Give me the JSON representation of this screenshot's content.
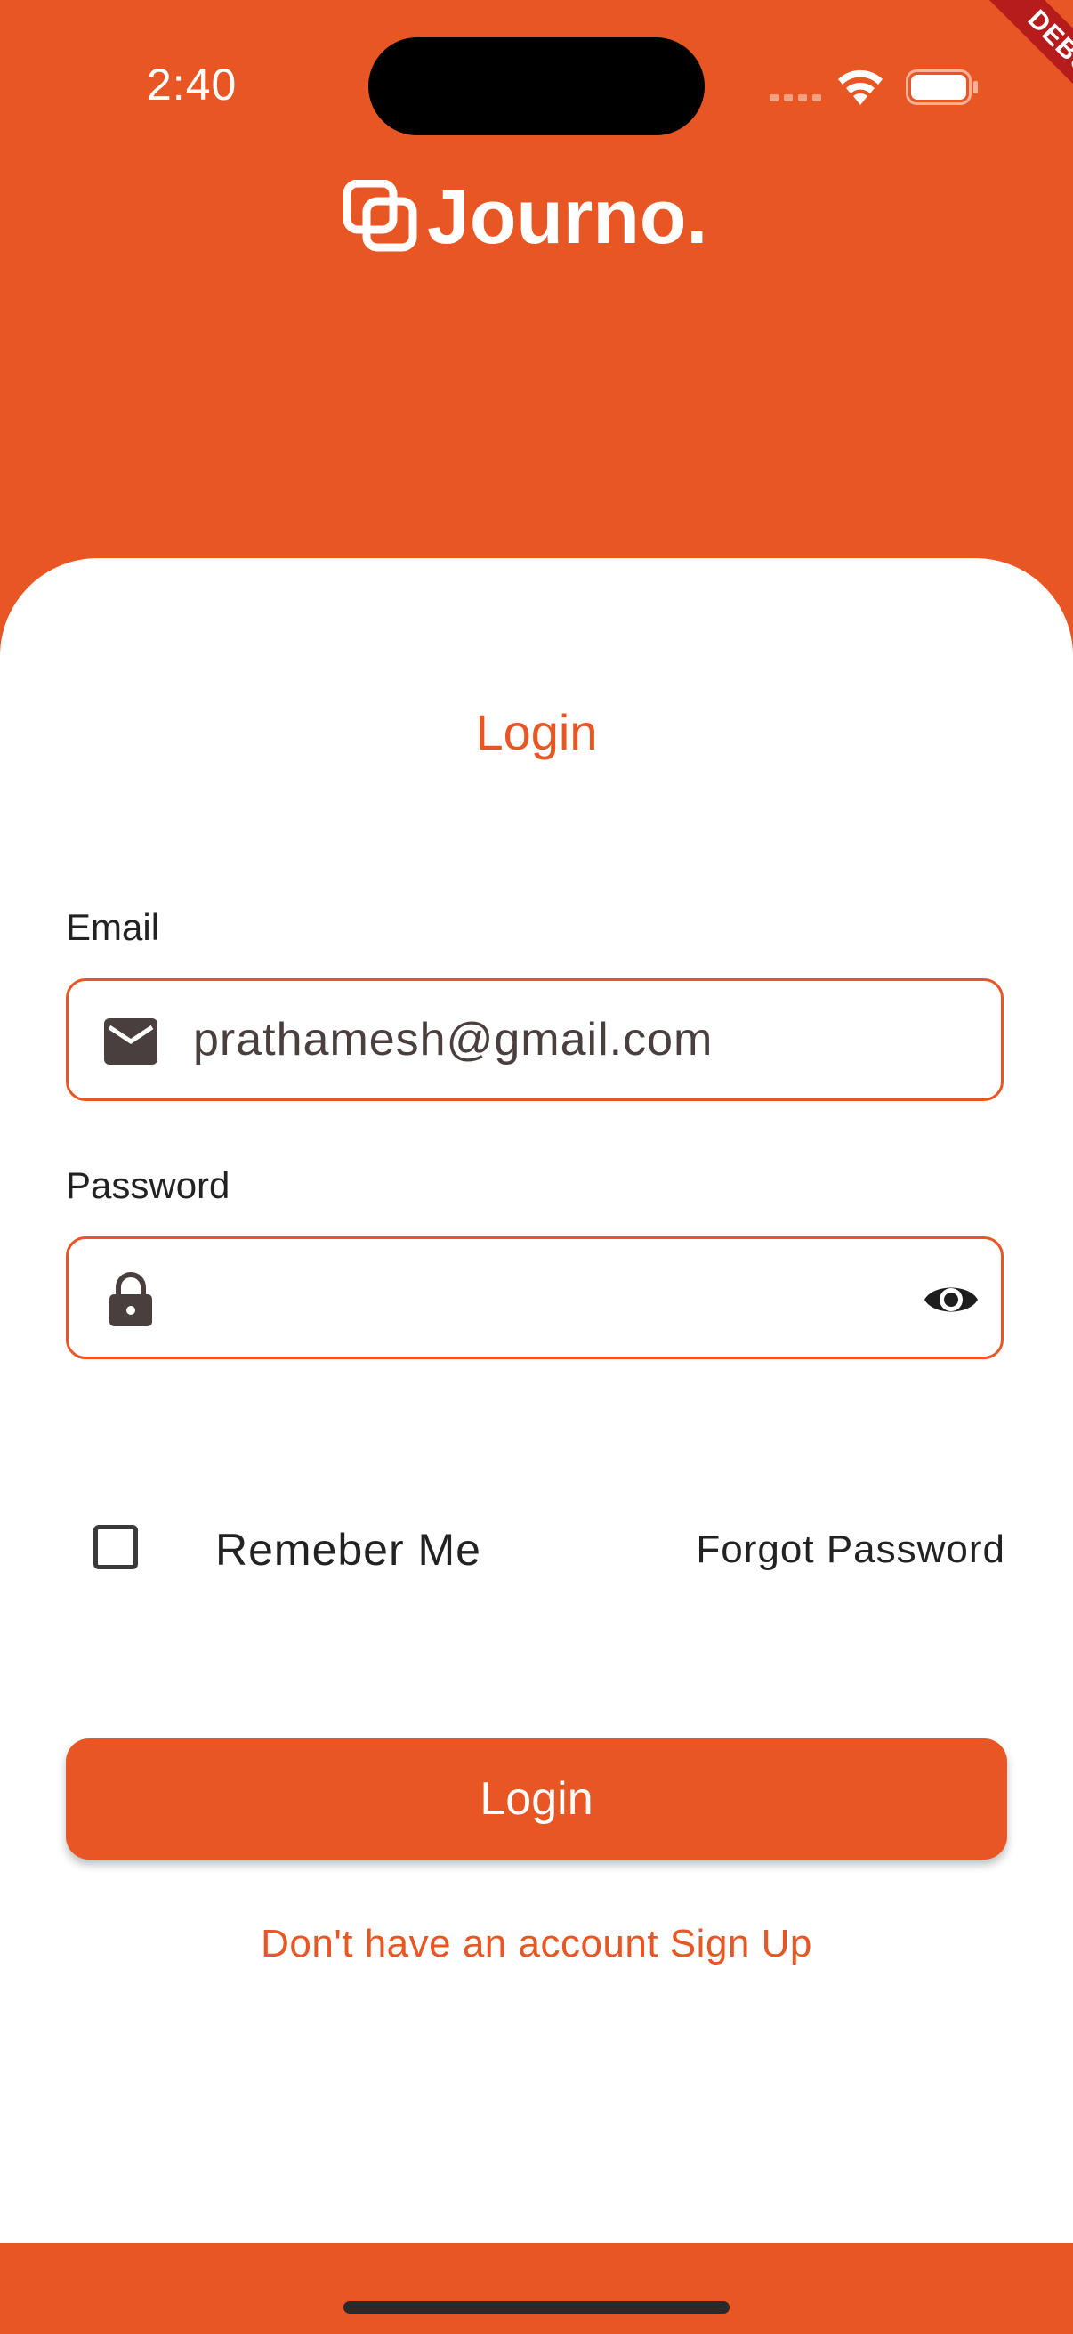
{
  "status_bar": {
    "time": "2:40"
  },
  "debug_banner": {
    "label": "DEBUG"
  },
  "app": {
    "name": "Journo."
  },
  "login_card": {
    "title": "Login",
    "email": {
      "label": "Email",
      "value": "prathamesh@gmail.com",
      "icon": "mail-icon"
    },
    "password": {
      "label": "Password",
      "value": "",
      "icon": "lock-icon",
      "toggle_icon": "eye-icon"
    },
    "remember_me": {
      "label": "Remeber Me",
      "checked": false
    },
    "forgot_password": "Forgot Password",
    "login_button": "Login",
    "signup_link": "Don't have an account Sign Up"
  },
  "colors": {
    "accent": "#e85623",
    "text": "#222222",
    "background": "#ffffff"
  }
}
